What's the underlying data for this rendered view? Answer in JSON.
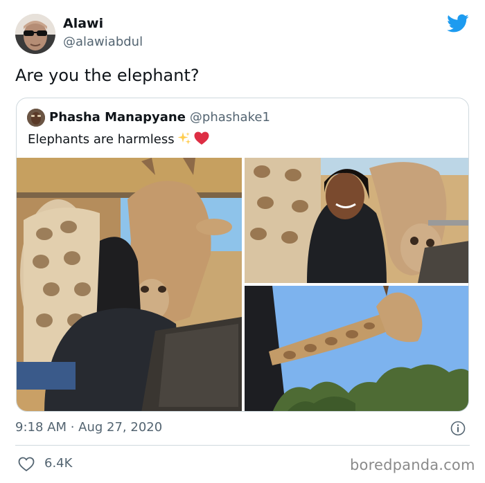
{
  "tweet": {
    "author_name": "Alawi",
    "author_handle": "@alawiabdul",
    "text": "Are you the elephant?",
    "timestamp": "9:18 AM · Aug 27, 2020",
    "likes": "6.4K"
  },
  "quoted_tweet": {
    "author_name": "Phasha Manapyane",
    "author_handle": "@phashake1",
    "text": "Elephants are harmless"
  },
  "icons": {
    "brand": "twitter-bird-icon",
    "info": "info-icon",
    "like": "heart-icon",
    "emoji": [
      "sparkles-emoji",
      "red-heart-emoji"
    ]
  },
  "colors": {
    "twitter_blue": "#1d9bf0",
    "secondary_text": "#536471",
    "border": "#cfd9de"
  },
  "watermark": "boredpanda.com"
}
